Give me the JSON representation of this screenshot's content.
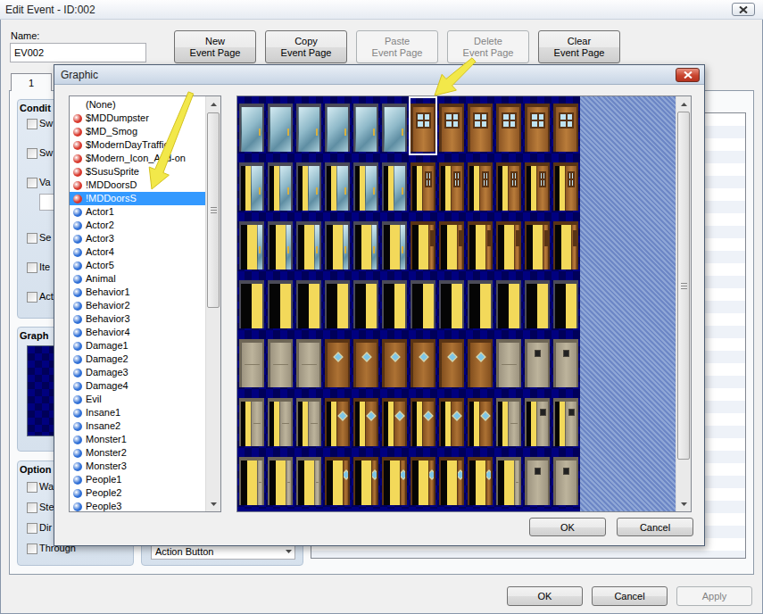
{
  "window": {
    "title": "Edit Event - ID:002"
  },
  "name": {
    "label": "Name:",
    "value": "EV002"
  },
  "page_buttons": [
    {
      "lines": [
        "New",
        "Event Page"
      ],
      "disabled": false
    },
    {
      "lines": [
        "Copy",
        "Event Page"
      ],
      "disabled": false
    },
    {
      "lines": [
        "Paste",
        "Event Page"
      ],
      "disabled": true
    },
    {
      "lines": [
        "Delete",
        "Event Page"
      ],
      "disabled": true
    },
    {
      "lines": [
        "Clear",
        "Event Page"
      ],
      "disabled": false
    }
  ],
  "tabs": [
    {
      "label": "1",
      "selected": true
    }
  ],
  "conditions": {
    "label": "Condit",
    "items": [
      {
        "label": "Sw",
        "checked": false,
        "kind": "plain"
      },
      {
        "label": "Sw",
        "checked": false,
        "kind": "plain"
      },
      {
        "label": "Va",
        "checked": false,
        "kind": "variable"
      },
      {
        "label": "Se",
        "checked": false,
        "kind": "plain"
      },
      {
        "label": "Ite",
        "checked": false,
        "kind": "plain"
      },
      {
        "label": "Act",
        "checked": false,
        "kind": "plain"
      }
    ]
  },
  "graphic_group": {
    "label": "Graph"
  },
  "options": {
    "label": "Option",
    "items": [
      {
        "label": "Wa",
        "checked": false
      },
      {
        "label": "Ste",
        "checked": false
      },
      {
        "label": "Dir",
        "checked": false
      },
      {
        "label": "Through",
        "checked": false
      }
    ]
  },
  "trigger": {
    "value": "Action Button"
  },
  "footer_buttons": [
    {
      "label": "OK",
      "disabled": false
    },
    {
      "label": "Cancel",
      "disabled": false
    },
    {
      "label": "Apply",
      "disabled": true
    }
  ],
  "graphic_dialog": {
    "title": "Graphic",
    "files": [
      {
        "label": "(None)",
        "selected": false
      },
      {
        "label": "$MDDumpster",
        "selected": false,
        "color": "#d8382c"
      },
      {
        "label": "$MD_Smog",
        "selected": false,
        "color": "#d8382c"
      },
      {
        "label": "$ModernDayTraffic",
        "selected": false,
        "color": "#d8382c"
      },
      {
        "label": "$Modern_Icon_Add-on",
        "selected": false,
        "color": "#d8382c"
      },
      {
        "label": "$SusuSprite",
        "selected": false,
        "color": "#d8382c"
      },
      {
        "label": "!MDDoorsD",
        "selected": false,
        "color": "#d8382c"
      },
      {
        "label": "!MDDoorsS",
        "selected": true,
        "color": "#d8382c"
      },
      {
        "label": "Actor1",
        "selected": false,
        "color": "#2f6fd6"
      },
      {
        "label": "Actor2",
        "selected": false,
        "color": "#2f6fd6"
      },
      {
        "label": "Actor3",
        "selected": false,
        "color": "#2f6fd6"
      },
      {
        "label": "Actor4",
        "selected": false,
        "color": "#2f6fd6"
      },
      {
        "label": "Actor5",
        "selected": false,
        "color": "#2f6fd6"
      },
      {
        "label": "Animal",
        "selected": false,
        "color": "#2f6fd6"
      },
      {
        "label": "Behavior1",
        "selected": false,
        "color": "#2f6fd6"
      },
      {
        "label": "Behavior2",
        "selected": false,
        "color": "#2f6fd6"
      },
      {
        "label": "Behavior3",
        "selected": false,
        "color": "#2f6fd6"
      },
      {
        "label": "Behavior4",
        "selected": false,
        "color": "#2f6fd6"
      },
      {
        "label": "Damage1",
        "selected": false,
        "color": "#2f6fd6"
      },
      {
        "label": "Damage2",
        "selected": false,
        "color": "#2f6fd6"
      },
      {
        "label": "Damage3",
        "selected": false,
        "color": "#2f6fd6"
      },
      {
        "label": "Damage4",
        "selected": false,
        "color": "#2f6fd6"
      },
      {
        "label": "Evil",
        "selected": false,
        "color": "#2f6fd6"
      },
      {
        "label": "Insane1",
        "selected": false,
        "color": "#2f6fd6"
      },
      {
        "label": "Insane2",
        "selected": false,
        "color": "#2f6fd6"
      },
      {
        "label": "Monster1",
        "selected": false,
        "color": "#2f6fd6"
      },
      {
        "label": "Monster2",
        "selected": false,
        "color": "#2f6fd6"
      },
      {
        "label": "Monster3",
        "selected": false,
        "color": "#2f6fd6"
      },
      {
        "label": "People1",
        "selected": false,
        "color": "#2f6fd6"
      },
      {
        "label": "People2",
        "selected": false,
        "color": "#2f6fd6"
      },
      {
        "label": "People3",
        "selected": false,
        "color": "#2f6fd6"
      }
    ],
    "sheet": {
      "rows": [
        [
          {
            "kind": "glass",
            "selected": false
          },
          {
            "kind": "glass",
            "selected": false
          },
          {
            "kind": "glass",
            "selected": false
          },
          {
            "kind": "glass",
            "selected": false
          },
          {
            "kind": "glass",
            "selected": false
          },
          {
            "kind": "glass",
            "selected": false
          },
          {
            "kind": "wood",
            "selected": true
          },
          {
            "kind": "wood",
            "selected": false
          },
          {
            "kind": "wood",
            "selected": false
          },
          {
            "kind": "wood",
            "selected": false
          },
          {
            "kind": "wood",
            "selected": false
          },
          {
            "kind": "wood",
            "selected": false
          }
        ],
        [
          {
            "kind": "glass-ajar",
            "selected": false
          },
          {
            "kind": "glass-ajar",
            "selected": false
          },
          {
            "kind": "glass-ajar",
            "selected": false
          },
          {
            "kind": "glass-ajar",
            "selected": false
          },
          {
            "kind": "glass-ajar",
            "selected": false
          },
          {
            "kind": "glass-ajar",
            "selected": false
          },
          {
            "kind": "wood-ajar",
            "selected": false
          },
          {
            "kind": "wood-ajar",
            "selected": false
          },
          {
            "kind": "wood-ajar",
            "selected": false
          },
          {
            "kind": "wood-ajar",
            "selected": false
          },
          {
            "kind": "wood-ajar",
            "selected": false
          },
          {
            "kind": "wood-ajar",
            "selected": false
          }
        ],
        [
          {
            "kind": "glass-open",
            "selected": false
          },
          {
            "kind": "glass-open",
            "selected": false
          },
          {
            "kind": "glass-open",
            "selected": false
          },
          {
            "kind": "glass-open",
            "selected": false
          },
          {
            "kind": "glass-open",
            "selected": false
          },
          {
            "kind": "glass-open",
            "selected": false
          },
          {
            "kind": "wood-open",
            "selected": false
          },
          {
            "kind": "wood-open",
            "selected": false
          },
          {
            "kind": "wood-open",
            "selected": false
          },
          {
            "kind": "wood-open",
            "selected": false
          },
          {
            "kind": "wood-open",
            "selected": false
          },
          {
            "kind": "wood-open",
            "selected": false
          }
        ],
        [
          {
            "kind": "doorway",
            "selected": false
          },
          {
            "kind": "doorway",
            "selected": false
          },
          {
            "kind": "doorway",
            "selected": false
          },
          {
            "kind": "doorway",
            "selected": false
          },
          {
            "kind": "doorway",
            "selected": false
          },
          {
            "kind": "doorway",
            "selected": false
          },
          {
            "kind": "doorway",
            "selected": false
          },
          {
            "kind": "doorway",
            "selected": false
          },
          {
            "kind": "doorway",
            "selected": false
          },
          {
            "kind": "doorway",
            "selected": false
          },
          {
            "kind": "doorway",
            "selected": false
          },
          {
            "kind": "doorway",
            "selected": false
          }
        ],
        [
          {
            "kind": "steel",
            "selected": false
          },
          {
            "kind": "steel",
            "selected": false
          },
          {
            "kind": "steel",
            "selected": false
          },
          {
            "kind": "ornate",
            "selected": false
          },
          {
            "kind": "ornate",
            "selected": false
          },
          {
            "kind": "ornate",
            "selected": false
          },
          {
            "kind": "ornate",
            "selected": false
          },
          {
            "kind": "ornate",
            "selected": false
          },
          {
            "kind": "ornate",
            "selected": false
          },
          {
            "kind": "steel",
            "selected": false
          },
          {
            "kind": "steelwin",
            "selected": false
          },
          {
            "kind": "steelwin",
            "selected": false
          }
        ],
        [
          {
            "kind": "steel-ajar",
            "selected": false
          },
          {
            "kind": "steel-ajar",
            "selected": false
          },
          {
            "kind": "steel-ajar",
            "selected": false
          },
          {
            "kind": "ornate-ajar",
            "selected": false
          },
          {
            "kind": "ornate-ajar",
            "selected": false
          },
          {
            "kind": "ornate-ajar",
            "selected": false
          },
          {
            "kind": "ornate-ajar",
            "selected": false
          },
          {
            "kind": "ornate-ajar",
            "selected": false
          },
          {
            "kind": "ornate-ajar",
            "selected": false
          },
          {
            "kind": "steel-ajar",
            "selected": false
          },
          {
            "kind": "steelwin-ajar",
            "selected": false
          },
          {
            "kind": "steelwin-ajar",
            "selected": false
          }
        ],
        [
          {
            "kind": "steel-open",
            "selected": false
          },
          {
            "kind": "steel-open",
            "selected": false
          },
          {
            "kind": "steel-open",
            "selected": false
          },
          {
            "kind": "ornate-open",
            "selected": false
          },
          {
            "kind": "ornate-open",
            "selected": false
          },
          {
            "kind": "ornate-open",
            "selected": false
          },
          {
            "kind": "ornate-open",
            "selected": false
          },
          {
            "kind": "ornate-open",
            "selected": false
          },
          {
            "kind": "ornate-open",
            "selected": false
          },
          {
            "kind": "steel-open",
            "selected": false
          },
          {
            "kind": "steelwin",
            "selected": false
          },
          {
            "kind": "steelwin",
            "selected": false
          }
        ]
      ]
    },
    "buttons": [
      {
        "label": "OK"
      },
      {
        "label": "Cancel"
      }
    ]
  }
}
